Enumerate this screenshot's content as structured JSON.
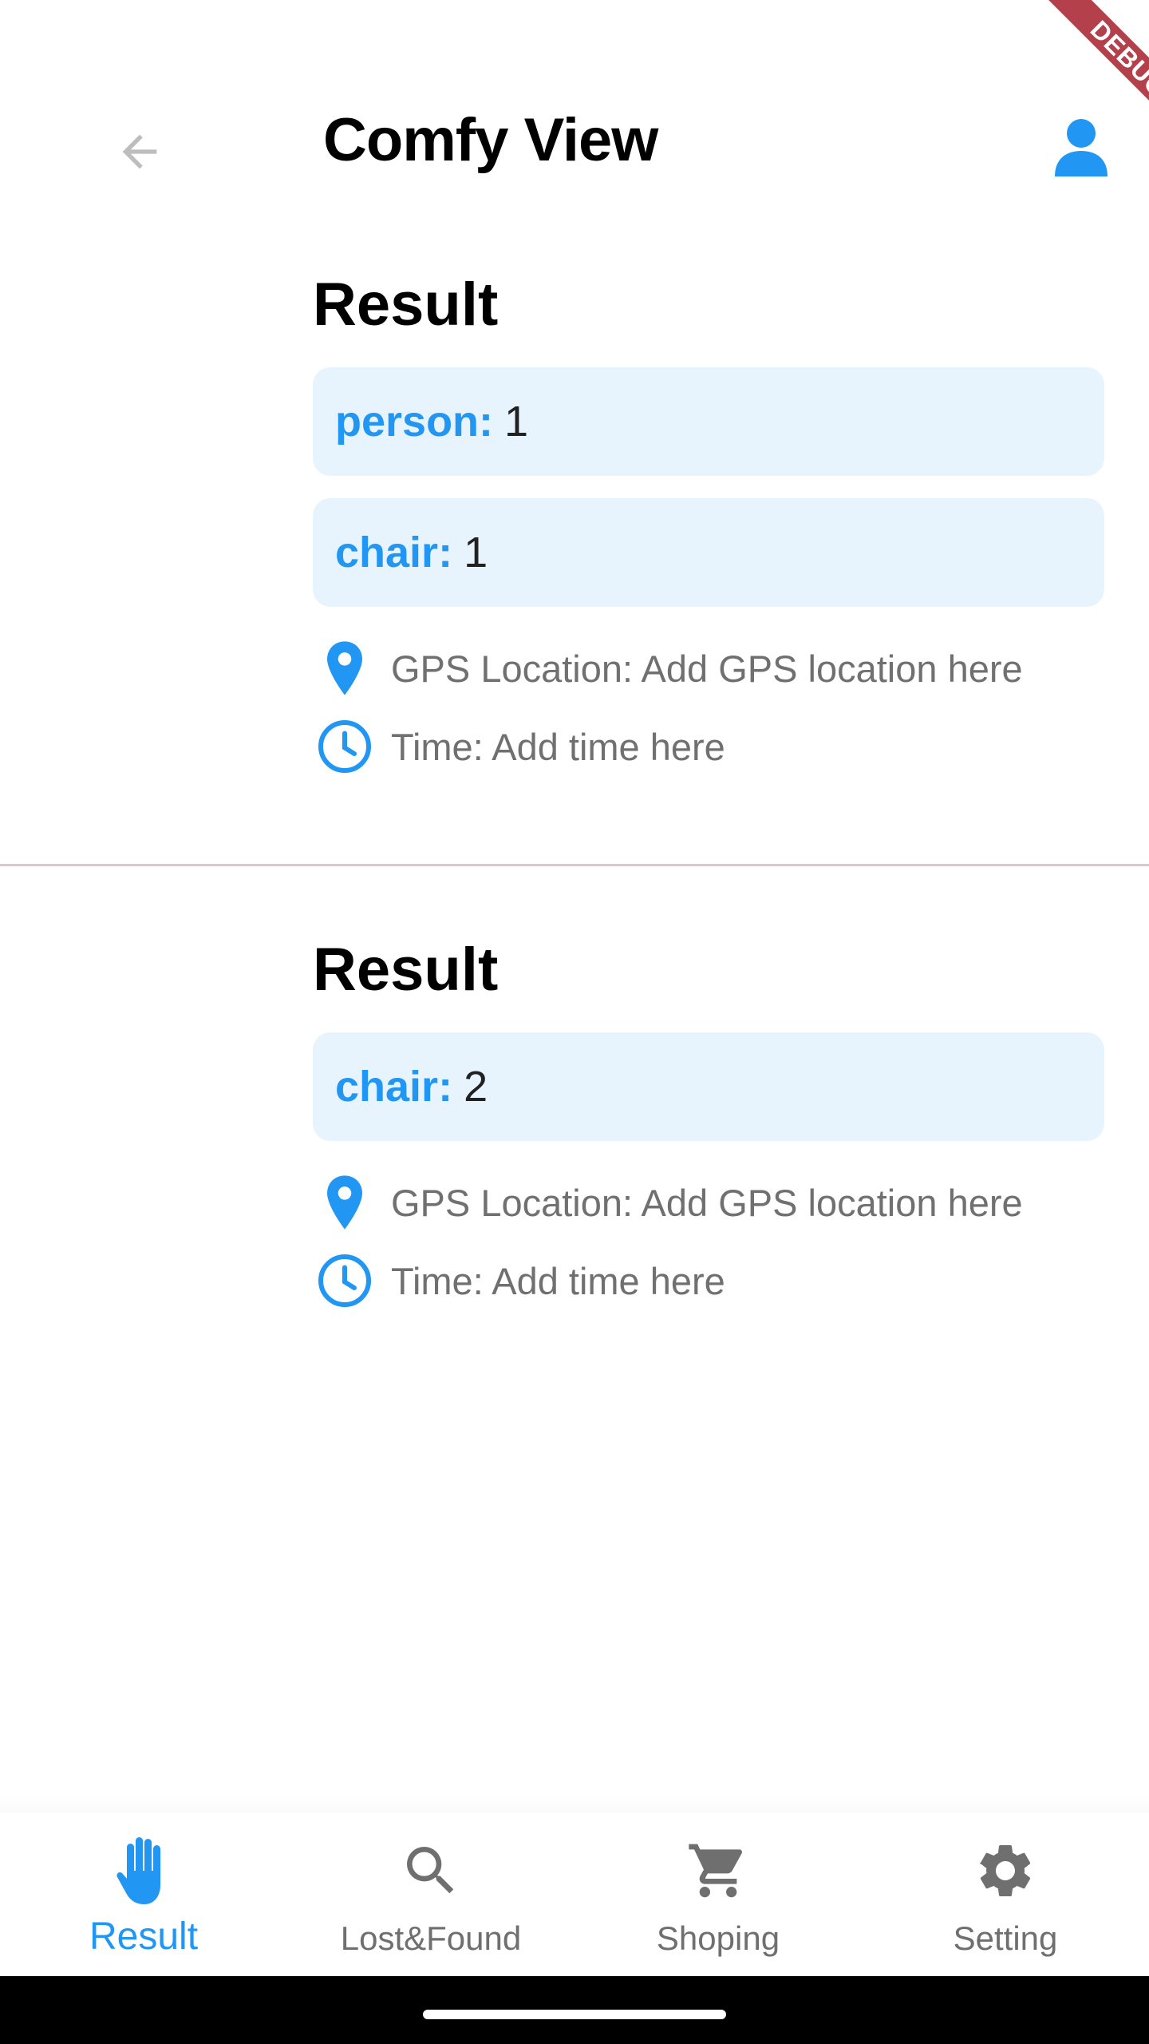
{
  "app_bar": {
    "title": "Comfy View"
  },
  "debug_banner": {
    "label": "DEBUG"
  },
  "results": [
    {
      "title": "Result",
      "items": [
        {
          "label": "person:",
          "count": "1"
        },
        {
          "label": "chair:",
          "count": "1"
        }
      ],
      "gps_text": "GPS Location: Add GPS location here",
      "time_text": "Time: Add time here"
    },
    {
      "title": "Result",
      "items": [
        {
          "label": "chair:",
          "count": "2"
        }
      ],
      "gps_text": "GPS Location: Add GPS location here",
      "time_text": "Time: Add time here"
    }
  ],
  "bottom_nav": {
    "items": [
      {
        "label": "Result",
        "icon": "hand-icon",
        "active": true
      },
      {
        "label": "Lost&Found",
        "icon": "search-icon",
        "active": false
      },
      {
        "label": "Shoping",
        "icon": "cart-icon",
        "active": false
      },
      {
        "label": "Setting",
        "icon": "gear-icon",
        "active": false
      }
    ]
  },
  "colors": {
    "accent": "#2196f3",
    "chip_background": "#e8f4fd",
    "muted_text": "#707070",
    "banner": "#b3404a",
    "status_dot": "#3ddc84"
  }
}
